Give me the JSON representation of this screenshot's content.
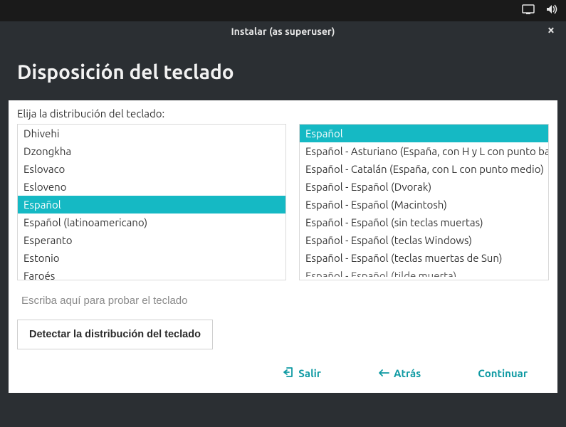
{
  "topbar": {
    "display_icon": "display",
    "sound_icon": "sound"
  },
  "window_title": "Instalar (as superuser)",
  "page_heading": "Disposición del teclado",
  "prompt": "Elija la distribución del teclado:",
  "left_list": {
    "items": [
      {
        "label": "Dhivehi",
        "selected": false
      },
      {
        "label": "Dzongkha",
        "selected": false
      },
      {
        "label": "Eslovaco",
        "selected": false
      },
      {
        "label": "Esloveno",
        "selected": false
      },
      {
        "label": "Español",
        "selected": true
      },
      {
        "label": "Español (latinoamericano)",
        "selected": false
      },
      {
        "label": "Esperanto",
        "selected": false
      },
      {
        "label": "Estonio",
        "selected": false
      },
      {
        "label": "Faroés",
        "selected": false
      }
    ]
  },
  "right_list": {
    "items": [
      {
        "label": "Español",
        "selected": true
      },
      {
        "label": "Español - Asturiano (España, con H y L con punto bajo)",
        "selected": false
      },
      {
        "label": "Español - Catalán (España, con L con punto medio)",
        "selected": false
      },
      {
        "label": "Español - Español (Dvorak)",
        "selected": false
      },
      {
        "label": "Español - Español (Macintosh)",
        "selected": false
      },
      {
        "label": "Español - Español (sin teclas muertas)",
        "selected": false
      },
      {
        "label": "Español - Español (teclas Windows)",
        "selected": false
      },
      {
        "label": "Español - Español (teclas muertas de Sun)",
        "selected": false
      },
      {
        "label": "Español - Español (tilde muerta)",
        "selected": false
      }
    ]
  },
  "test_placeholder": "Escriba aquí para probar el teclado",
  "detect_button": "Detectar la distribución del teclado",
  "nav": {
    "quit": "Salir",
    "back": "Atrás",
    "continue": "Continuar"
  }
}
